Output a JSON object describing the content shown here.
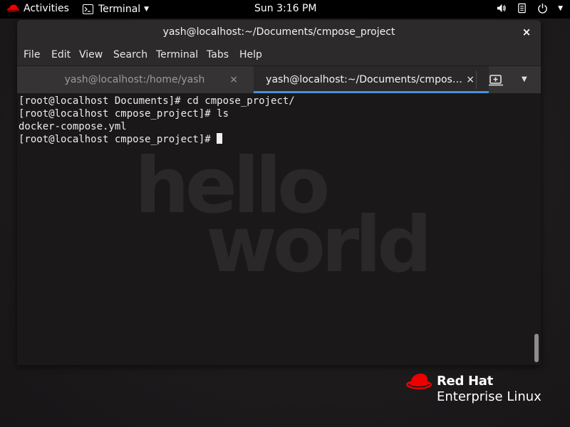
{
  "topbar": {
    "activities": "Activities",
    "app_menu": "Terminal",
    "clock": "Sun  3:16 PM"
  },
  "window": {
    "title": "yash@localhost:~/Documents/cmpose_project",
    "close_glyph": "×"
  },
  "menubar": {
    "items": [
      "File",
      "Edit",
      "View",
      "Search",
      "Terminal",
      "Tabs",
      "Help"
    ]
  },
  "tabs": [
    {
      "label": "yash@localhost:/home/yash",
      "close": "×",
      "active": false
    },
    {
      "label": "yash@localhost:~/Documents/cmpos…",
      "close": "×",
      "active": true
    }
  ],
  "terminal": {
    "lines": [
      "[root@localhost Documents]# cd cmpose_project/",
      "[root@localhost cmpose_project]# ls",
      "docker-compose.yml",
      "[root@localhost cmpose_project]# "
    ],
    "scroll_position": 1.0
  },
  "watermark": {
    "line1": "hello",
    "line2": "world"
  },
  "branding": {
    "line1": "Red Hat",
    "line2": "Enterprise Linux"
  },
  "icons": {
    "logo": "redhat-logo-icon",
    "app": "terminal-icon",
    "volume": "volume-icon",
    "power": "power-icon",
    "new_tab": "new-tab-icon",
    "tab_menu": "chevron-down-icon"
  },
  "colors": {
    "accent": "#4a90d9",
    "brand_red": "#ee0000",
    "terminal_bg": "#1a1819"
  }
}
